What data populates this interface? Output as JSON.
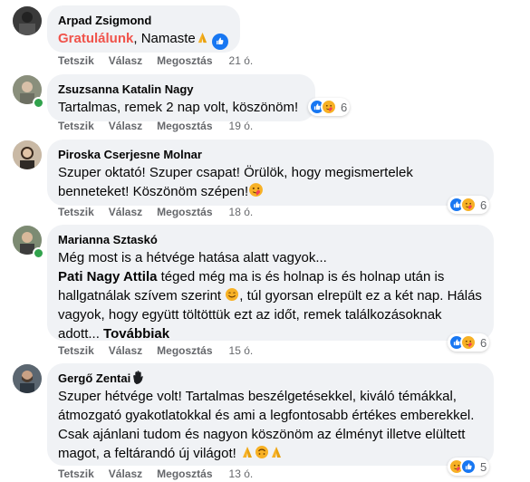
{
  "actions": {
    "like": "Tetszik",
    "reply": "Válasz",
    "share": "Megosztás"
  },
  "comments": [
    {
      "name": "Arpad Zsigmond",
      "text_highlight": "Gratulálunk",
      "text_rest": ", Namaste",
      "time": "21 ó."
    },
    {
      "name": "Zsuzsanna Katalin Nagy",
      "text": "Tartalmas, remek 2 nap volt, köszönöm!",
      "reactions": "6",
      "time": "19 ó."
    },
    {
      "name": "Piroska Cserjesne Molnar",
      "text": "Szuper oktató! Szuper csapat! Örülök, hogy megismertelek benneteket! Köszönöm szépen!",
      "reactions": "6",
      "time": "18 ó."
    },
    {
      "name": "Marianna Sztaskó",
      "line1": "Még most is a hétvége hatása alatt vagyok...",
      "tag": "Pati Nagy Attila",
      "text_after_tag": " téged még ma is és holnap is és holnap után is hallgatnálak szívem szerint",
      "text_rest": ", túl gyorsan elrepült ez a két nap. Hálás vagyok, hogy együtt töltöttük ezt az időt, remek találkozásoknak adott...",
      "more": "Továbbiak",
      "reactions": "6",
      "time": "15 ó."
    },
    {
      "name": "Gergő Zentai",
      "text": "Szuper hétvége volt! Tartalmas beszélgetésekkel, kiváló témákkal, átmozgató gyakotlatokkal és ami a legfontosabb értékes emberekkel. Csak ajánlani tudom és nagyon köszönöm az élményt illetve elültett magot, a feltárandó új világot!",
      "reactions": "5",
      "time": "13 ó."
    }
  ],
  "colors": {
    "bubble": "#f0f2f5",
    "meta": "#65676b",
    "like": "#1877f2",
    "highlight": "#f0534b",
    "online": "#31a24c"
  }
}
